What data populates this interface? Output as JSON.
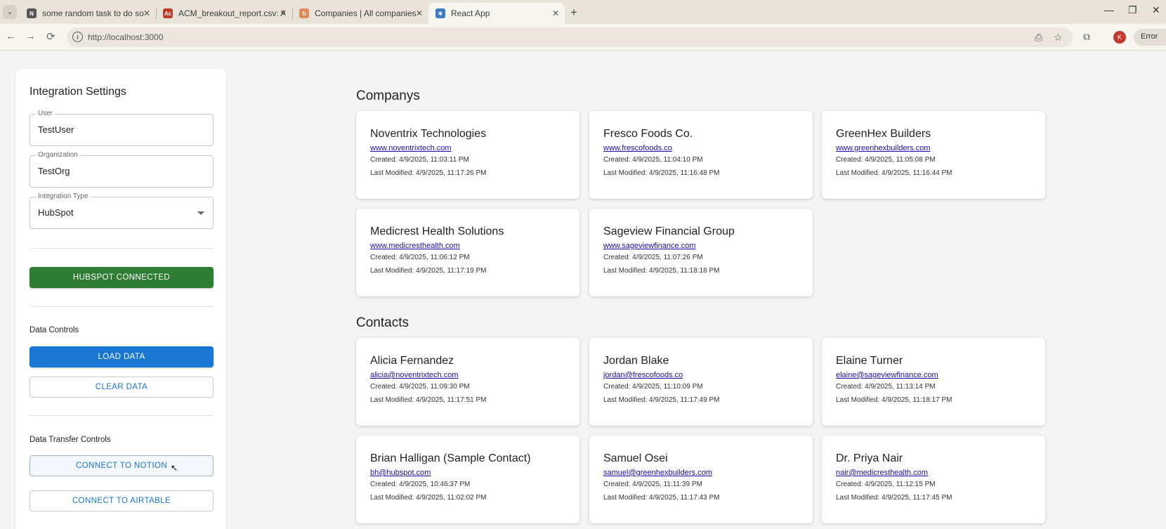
{
  "browser": {
    "tabs": [
      {
        "title": "some random task to do so",
        "favicon_color": "#555555",
        "favicon_letter": "N"
      },
      {
        "title": "ACM_breakout_report.csv: ACM",
        "favicon_color": "#c0392b",
        "favicon_letter": "Ac"
      },
      {
        "title": "Companies | All companies",
        "favicon_color": "#e08a5b",
        "favicon_letter": "h"
      },
      {
        "title": "React App",
        "favicon_color": "#3b7bbf",
        "favicon_letter": "⚛"
      }
    ],
    "active_tab": 3,
    "url": "http://localhost:3000",
    "profile_initial": "K",
    "error_label": "Error"
  },
  "sidebar": {
    "title": "Integration Settings",
    "user": {
      "label": "User",
      "value": "TestUser"
    },
    "organization": {
      "label": "Organization",
      "value": "TestOrg"
    },
    "integration_type": {
      "label": "Integration Type",
      "value": "HubSpot"
    },
    "connected_button": "HUBSPOT CONNECTED",
    "data_controls_heading": "Data Controls",
    "load_button": "LOAD DATA",
    "clear_button": "CLEAR DATA",
    "transfer_heading": "Data Transfer Controls",
    "notion_button": "CONNECT TO NOTION",
    "airtable_button": "CONNECT TO AIRTABLE"
  },
  "colors": {
    "connected": "#2e7d32",
    "primary": "#1976d2",
    "link": "#1a0dab"
  },
  "companies": {
    "heading": "Companys",
    "items": [
      {
        "name": "Noventrix Technologies",
        "link": "www.noventrixtech.com",
        "created": "Created: 4/9/2025, 11:03:11 PM",
        "modified": "Last Modified: 4/9/2025, 11:17:26 PM"
      },
      {
        "name": "Fresco Foods Co.",
        "link": "www.frescofoods.co",
        "created": "Created: 4/9/2025, 11:04:10 PM",
        "modified": "Last Modified: 4/9/2025, 11:16:48 PM"
      },
      {
        "name": "GreenHex Builders",
        "link": "www.greenhexbuilders.com",
        "created": "Created: 4/9/2025, 11:05:08 PM",
        "modified": "Last Modified: 4/9/2025, 11:16:44 PM"
      },
      {
        "name": "Medicrest Health Solutions",
        "link": "www.medicresthealth.com",
        "created": "Created: 4/9/2025, 11:06:12 PM",
        "modified": "Last Modified: 4/9/2025, 11:17:19 PM"
      },
      {
        "name": "Sageview Financial Group",
        "link": "www.sageviewfinance.com",
        "created": "Created: 4/9/2025, 11:07:26 PM",
        "modified": "Last Modified: 4/9/2025, 11:18:18 PM"
      }
    ]
  },
  "contacts": {
    "heading": "Contacts",
    "items": [
      {
        "name": "Alicia Fernandez",
        "link": "alicia@noventrixtech.com",
        "created": "Created: 4/9/2025, 11:09:30 PM",
        "modified": "Last Modified: 4/9/2025, 11:17:51 PM"
      },
      {
        "name": "Jordan Blake",
        "link": "jordan@frescofoods.co",
        "created": "Created: 4/9/2025, 11:10:09 PM",
        "modified": "Last Modified: 4/9/2025, 11:17:49 PM"
      },
      {
        "name": "Elaine Turner",
        "link": "elaine@sageviewfinance.com",
        "created": "Created: 4/9/2025, 11:13:14 PM",
        "modified": "Last Modified: 4/9/2025, 11:18:17 PM"
      },
      {
        "name": "Brian Halligan (Sample Contact)",
        "link": "bh@hubspot.com",
        "created": "Created: 4/9/2025, 10:46:37 PM",
        "modified": "Last Modified: 4/9/2025, 11:02:02 PM"
      },
      {
        "name": "Samuel Osei",
        "link": "samuel@greenhexbuilders.com",
        "created": "Created: 4/9/2025, 11:11:39 PM",
        "modified": "Last Modified: 4/9/2025, 11:17:43 PM"
      },
      {
        "name": "Dr. Priya Nair",
        "link": "nair@medicresthealth.com",
        "created": "Created: 4/9/2025, 11:12:15 PM",
        "modified": "Last Modified: 4/9/2025, 11:17:45 PM"
      }
    ]
  }
}
